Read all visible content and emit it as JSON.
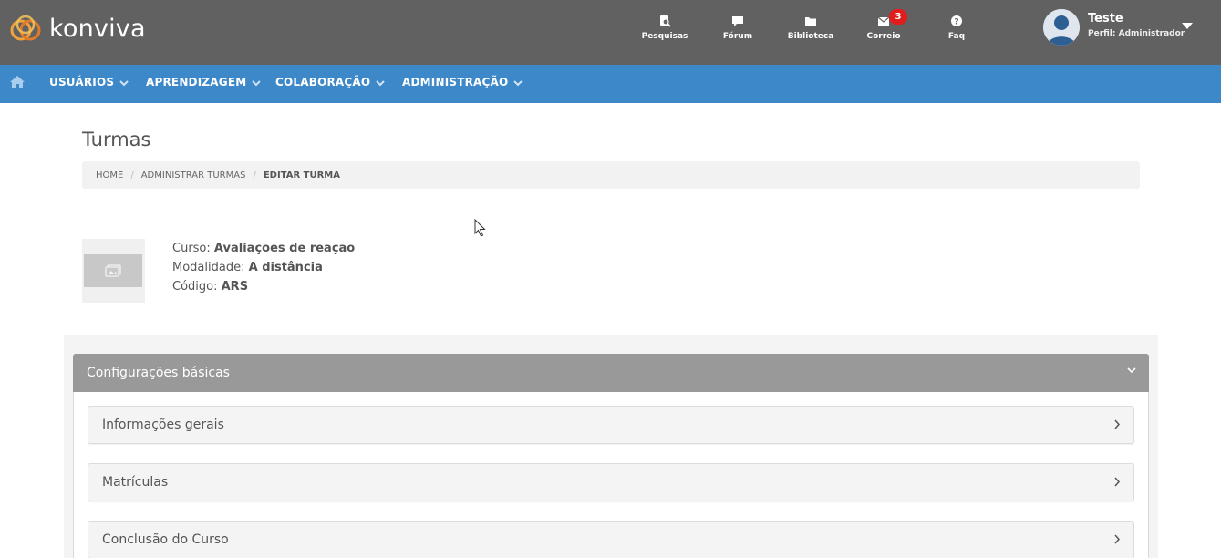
{
  "brand": {
    "name": "konviva"
  },
  "topnav": [
    {
      "label": "Pesquisas",
      "icon": "search-doc-icon"
    },
    {
      "label": "Fórum",
      "icon": "chat-icon"
    },
    {
      "label": "Biblioteca",
      "icon": "folder-icon"
    },
    {
      "label": "Correio",
      "icon": "mail-icon",
      "badge": "3"
    },
    {
      "label": "Faq",
      "icon": "question-icon"
    }
  ],
  "user": {
    "name": "Teste",
    "profile": "Perfil: Administrador"
  },
  "menu": [
    {
      "label": "USUÁRIOS"
    },
    {
      "label": "APRENDIZAGEM"
    },
    {
      "label": "COLABORAÇÃO"
    },
    {
      "label": "ADMINISTRAÇÃO"
    }
  ],
  "page": {
    "title": "Turmas"
  },
  "breadcrumb": {
    "home": "HOME",
    "parent": "ADMINISTRAR TURMAS",
    "current": "EDITAR TURMA"
  },
  "course": {
    "curso_label": "Curso:",
    "curso_value": "Avaliações de reação",
    "modalidade_label": "Modalidade:",
    "modalidade_value": "A distância",
    "codigo_label": "Código:",
    "codigo_value": "ARS"
  },
  "panel": {
    "title": "Configurações básicas",
    "items": [
      {
        "label": "Informações gerais"
      },
      {
        "label": "Matrículas"
      },
      {
        "label": "Conclusão do Curso"
      }
    ]
  },
  "colors": {
    "topbar": "#616161",
    "menubar": "#3d88c9",
    "panel_header": "#999999",
    "badge": "#e11c1c"
  }
}
